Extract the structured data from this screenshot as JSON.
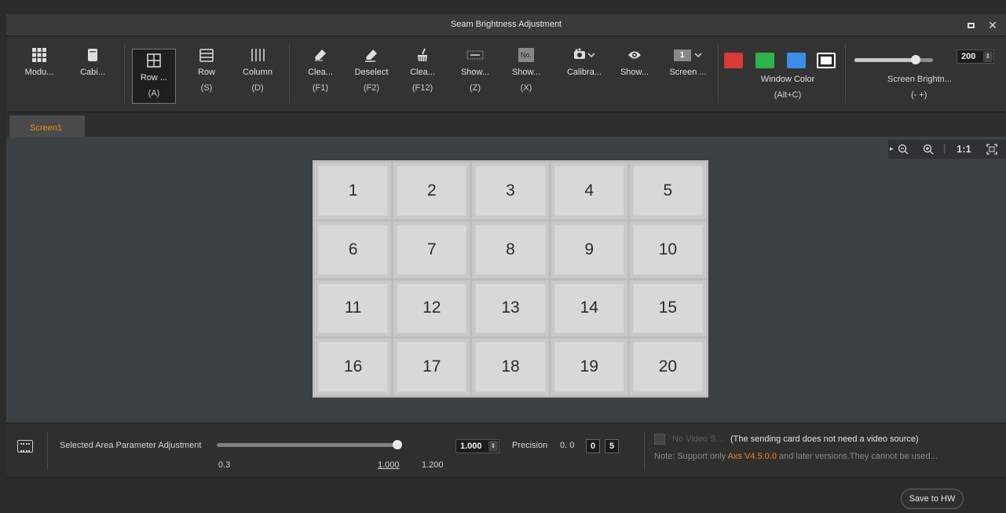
{
  "window": {
    "title": "Seam Brightness Adjustment"
  },
  "toolbar": {
    "tools": [
      {
        "label": "Modu...",
        "key": "",
        "icon": "grid-icon"
      },
      {
        "label": "Cabi...",
        "key": "",
        "icon": "cabinet-icon"
      },
      {
        "label": "Row ...",
        "key": "(A)",
        "icon": "row-column-icon"
      },
      {
        "label": "Row",
        "key": "(S)",
        "icon": "row-icon"
      },
      {
        "label": "Column",
        "key": "(D)",
        "icon": "column-icon"
      },
      {
        "label": "Clea...",
        "key": "(F1)",
        "icon": "eraser-icon"
      },
      {
        "label": "Deselect",
        "key": "(F2)",
        "icon": "deselect-icon"
      },
      {
        "label": "Clea...",
        "key": "(F12)",
        "icon": "broom-icon"
      },
      {
        "label": "Show...",
        "key": "(Z)",
        "icon": "seam-lines-icon"
      },
      {
        "label": "Show...",
        "key": "(X)",
        "icon": "number-icon"
      },
      {
        "label": "Calibra...",
        "key": "",
        "icon": "calibration-icon"
      },
      {
        "label": "Show...",
        "key": "",
        "icon": "eye-icon"
      },
      {
        "label": "Screen ...",
        "key": "",
        "icon": "screen-number-icon"
      }
    ],
    "number_icon_text": "No.",
    "screen_badge": "1",
    "window_color": {
      "label": "Window Color",
      "key": "(Alt+C)",
      "colors": [
        "#d63b34",
        "#2eb34a",
        "#3a8ee8",
        "#ffffff"
      ]
    },
    "brightness": {
      "label": "Screen Brightn...",
      "keys": "(-   +)",
      "value": "200",
      "max": 255
    }
  },
  "tabs": [
    "Screen1"
  ],
  "zoom": {
    "fit_label": "1:1"
  },
  "grid": {
    "cells": [
      "1",
      "2",
      "3",
      "4",
      "5",
      "6",
      "7",
      "8",
      "9",
      "10",
      "11",
      "12",
      "13",
      "14",
      "15",
      "16",
      "17",
      "18",
      "19",
      "20"
    ]
  },
  "bottom": {
    "adjust_label": "Selected Area Parameter Adjustment",
    "min": "0.3",
    "current": "1.000",
    "max": "1.200",
    "value_box": "1.000",
    "precision_label": "Precision",
    "precision_prefix": "0. 0",
    "precision_digit1": "0",
    "precision_digit2": "5",
    "no_video_label": "No Video S...",
    "no_video_note": "(The sending card does not need a video source)",
    "note_prefix": "Note: Support only ",
    "note_version": "Axs V4.5.0.0",
    "note_suffix": " and later versions.They cannot be used..."
  },
  "footer": {
    "save_label": "Save to HW"
  },
  "colors": {
    "accent": "#f08a1c"
  }
}
